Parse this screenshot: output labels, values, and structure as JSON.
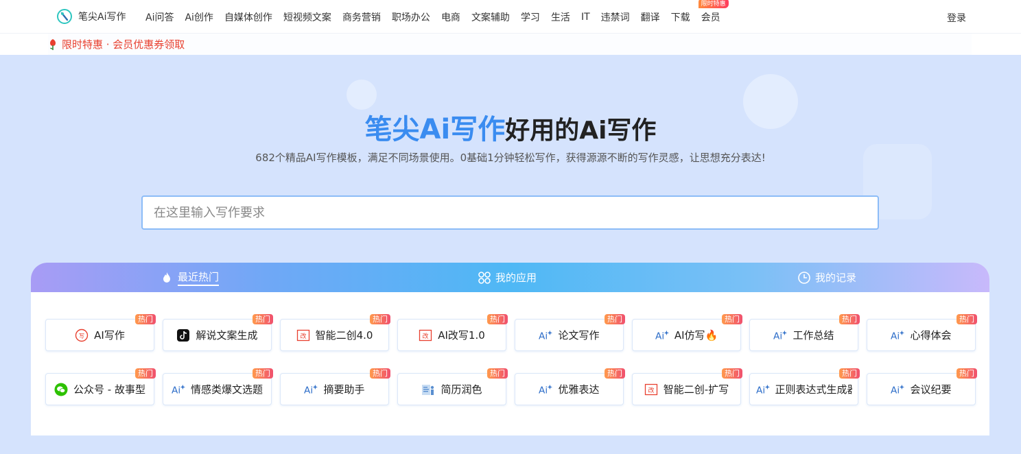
{
  "brand": {
    "name": "笔尖Ai写作"
  },
  "nav": {
    "items": [
      "Ai问答",
      "Ai创作",
      "自媒体创作",
      "短视频文案",
      "商务营销",
      "职场办公",
      "电商",
      "文案辅助",
      "学习",
      "生活",
      "IT",
      "违禁词",
      "翻译",
      "下载",
      "会员"
    ],
    "vip_badge": "限时特惠",
    "login": "登录"
  },
  "promo": {
    "text": "限时特惠 · 会员优惠券领取"
  },
  "hero": {
    "brand": "笔尖Ai写作",
    "title_rest": "好用的Ai写作",
    "subtitle": "682个精品AI写作模板，满足不同场景使用。0基础1分钟轻松写作，获得源源不断的写作灵感，让思想充分表达!"
  },
  "search": {
    "placeholder": "在这里输入写作要求",
    "value": ""
  },
  "tabs": [
    {
      "label": "最近热门",
      "icon": "flame-icon",
      "active": true
    },
    {
      "label": "我的应用",
      "icon": "apps-icon",
      "active": false
    },
    {
      "label": "我的记录",
      "icon": "clock-icon",
      "active": false
    }
  ],
  "hot_label": "热门",
  "cards": [
    {
      "label": "AI写作",
      "icon": "ai-write-icon"
    },
    {
      "label": "解说文案生成",
      "icon": "tiktok-icon"
    },
    {
      "label": "智能二创4.0",
      "icon": "rewrite-icon"
    },
    {
      "label": "AI改写1.0",
      "icon": "rewrite-icon"
    },
    {
      "label": "论文写作",
      "icon": "ai-spark-icon"
    },
    {
      "label": "AI仿写🔥",
      "icon": "ai-spark-icon"
    },
    {
      "label": "工作总结",
      "icon": "ai-spark-icon"
    },
    {
      "label": "心得体会",
      "icon": "ai-spark-icon"
    },
    {
      "label": "公众号 - 故事型",
      "icon": "wechat-icon"
    },
    {
      "label": "情感类爆文选题",
      "icon": "ai-spark-icon"
    },
    {
      "label": "摘要助手",
      "icon": "ai-spark-icon"
    },
    {
      "label": "简历润色",
      "icon": "resume-icon"
    },
    {
      "label": "优雅表达",
      "icon": "ai-spark-icon"
    },
    {
      "label": "智能二创-扩写",
      "icon": "rewrite-icon"
    },
    {
      "label": "正则表达式生成器",
      "icon": "ai-spark-icon"
    },
    {
      "label": "会议纪要",
      "icon": "ai-spark-icon"
    }
  ],
  "colors": {
    "accent": "#3a8cf0",
    "hot": "#f0506e",
    "promo": "#e8402f",
    "background": "#d5e3fd"
  }
}
